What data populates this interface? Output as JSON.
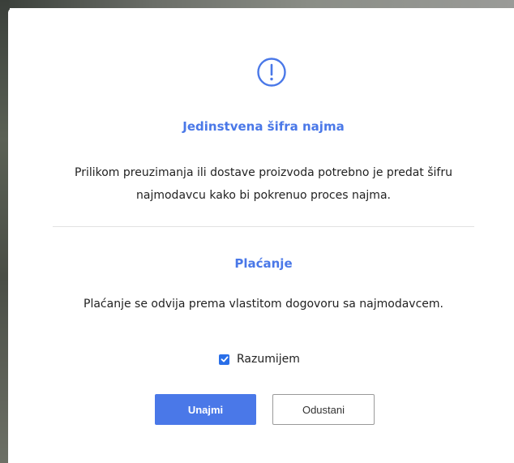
{
  "icons": {
    "alert": "exclamation-circle-icon",
    "checkbox": "checkmark-icon"
  },
  "colors": {
    "accent": "#4a78e8",
    "checkbox": "#2a6fe8",
    "text": "#222222",
    "divider": "#e2e2e2"
  },
  "modal": {
    "section1": {
      "title": "Jedinstvena šifra najma",
      "line1": "Prilikom preuzimanja ili dostave proizvoda potrebno je predat šifru",
      "line2": "najmodavcu kako bi pokrenuo proces najma."
    },
    "section2": {
      "title": "Plaćanje",
      "text": "Plaćanje se odvija prema vlastitom dogovoru sa najmodavcem."
    },
    "checkbox": {
      "label": "Razumijem",
      "checked": true
    },
    "buttons": {
      "confirm": "Unajmi",
      "cancel": "Odustani"
    }
  }
}
